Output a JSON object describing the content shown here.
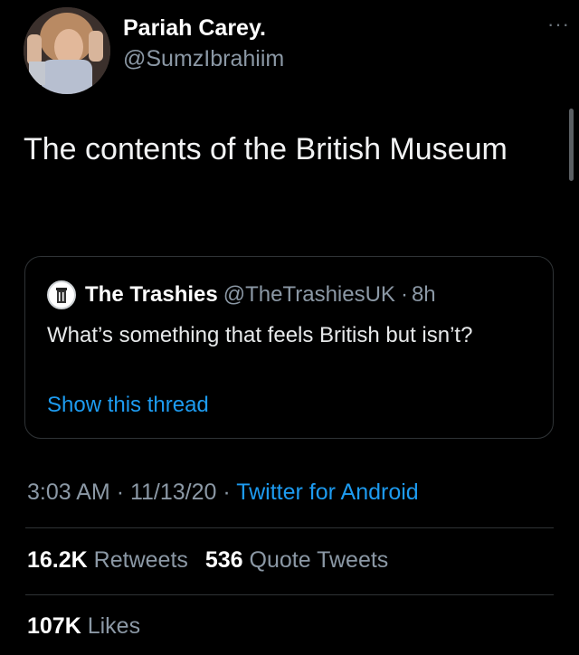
{
  "tweet": {
    "display_name": "Pariah Carey.",
    "handle": "@SumzIbrahiim",
    "more_icon": "more-horizontal-icon",
    "text": "The contents of the British Museum",
    "timestamp_time": "3:03 AM",
    "timestamp_date": "11/13/20",
    "separator": "·",
    "source": "Twitter for Android"
  },
  "quoted_tweet": {
    "display_name": "The Trashies",
    "handle": "@TheTrashiesUK",
    "separator": "·",
    "age": "8h",
    "text": "What’s something that feels British but isn’t?",
    "show_thread": "Show this thread",
    "avatar_icon": "trash-can-logo-icon"
  },
  "stats": {
    "retweets_count": "16.2K",
    "retweets_label": "Retweets",
    "quotes_count": "536",
    "quotes_label": "Quote Tweets",
    "likes_count": "107K",
    "likes_label": "Likes"
  },
  "colors": {
    "background": "#000000",
    "link": "#1d9bf0",
    "secondary_text": "#8b98a5",
    "border": "#2f3336"
  }
}
